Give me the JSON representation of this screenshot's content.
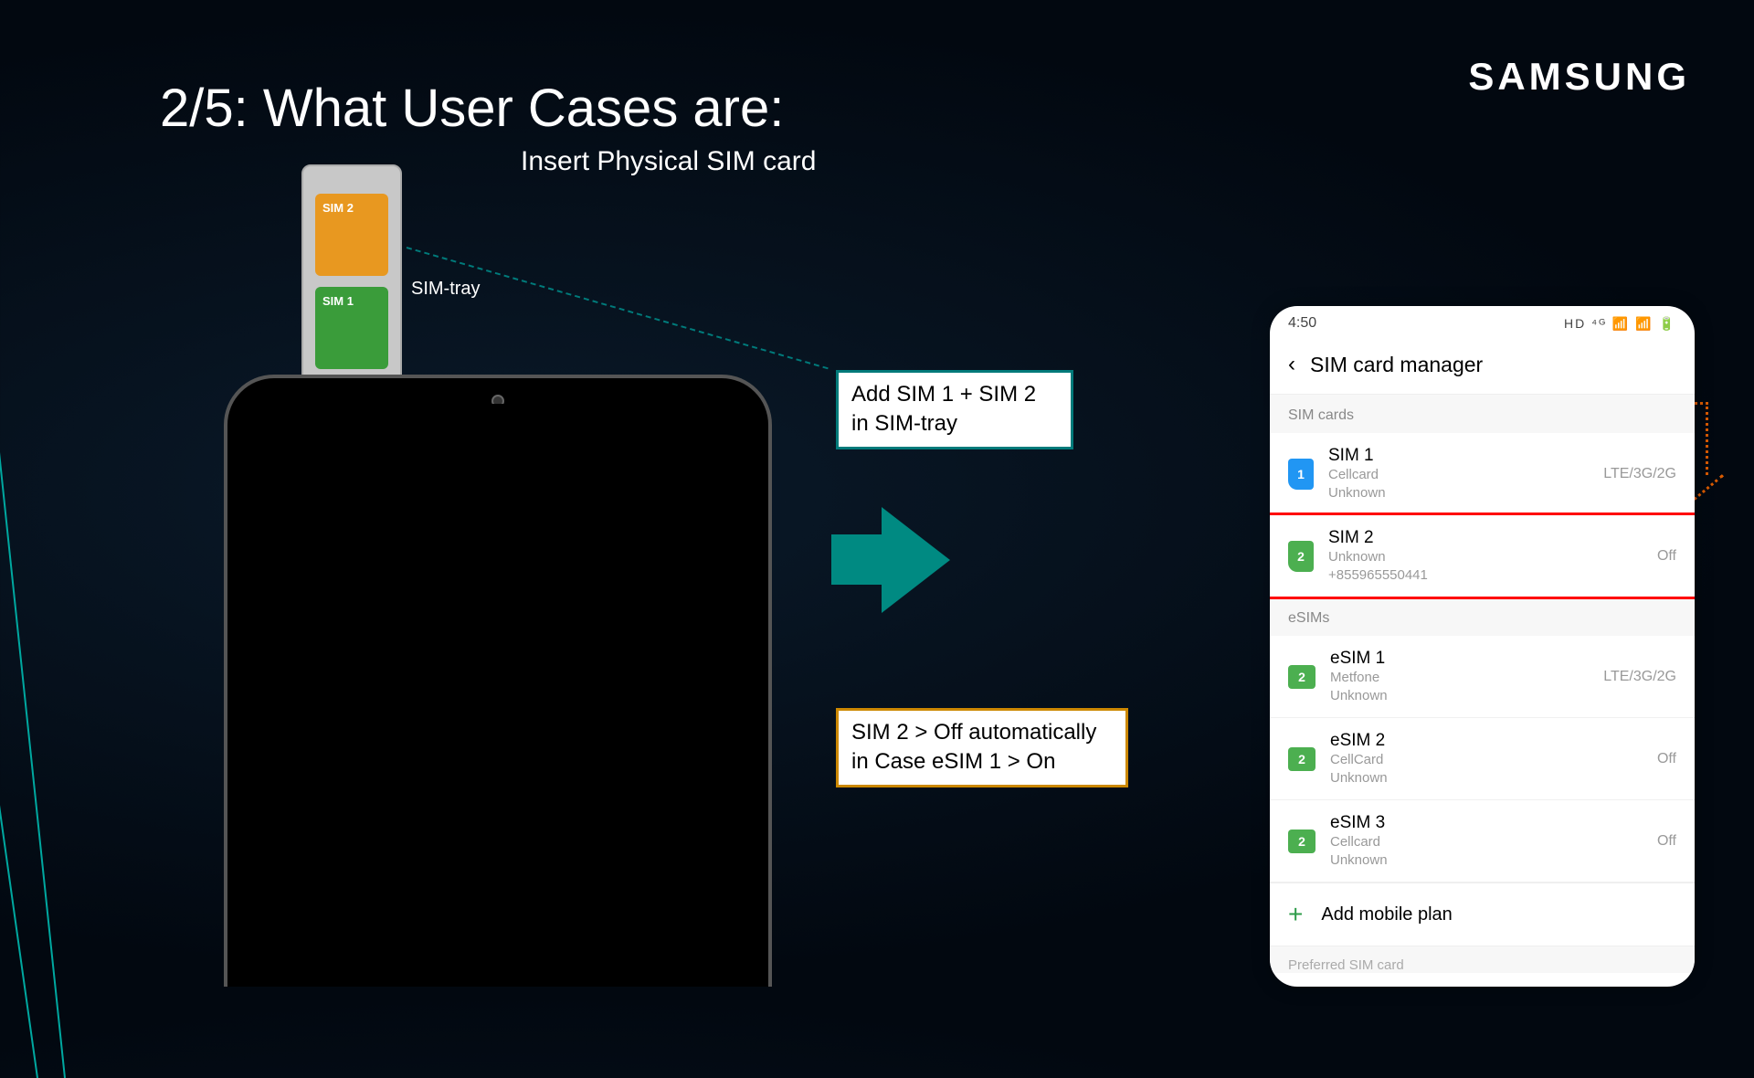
{
  "brand": "SAMSUNG",
  "title": "2/5: What User Cases are:",
  "subtitle": "Insert Physical SIM card",
  "tray": {
    "sim2_label": "SIM 2",
    "sim1_label": "SIM 1",
    "caption": "SIM-tray"
  },
  "callouts": {
    "teal": "Add SIM 1 + SIM 2 in SIM-tray",
    "orange": "SIM 2 > Off automatically in Case eSIM 1 > On"
  },
  "screenshot": {
    "time": "4:50",
    "status_icons": "HD ⁴ᴳ 📶 📶 🔋",
    "screen_title": "SIM card manager",
    "sections": {
      "sim_cards_label": "SIM cards",
      "esims_label": "eSIMs",
      "preferred_label": "Preferred SIM card"
    },
    "sims": [
      {
        "icon_num": "1",
        "name": "SIM 1",
        "carrier": "Cellcard",
        "phone": "Unknown",
        "status": "LTE/3G/2G"
      },
      {
        "icon_num": "2",
        "name": "SIM 2",
        "carrier": "Unknown",
        "phone": "+855965550441",
        "status": "Off"
      }
    ],
    "esims": [
      {
        "icon_num": "2",
        "name": "eSIM 1",
        "carrier": "Metfone",
        "phone": "Unknown",
        "status": "LTE/3G/2G"
      },
      {
        "icon_num": "2",
        "name": "eSIM 2",
        "carrier": "CellCard",
        "phone": "Unknown",
        "status": "Off"
      },
      {
        "icon_num": "2",
        "name": "eSIM 3",
        "carrier": "Cellcard",
        "phone": "Unknown",
        "status": "Off"
      }
    ],
    "add_plan": "Add mobile plan"
  }
}
